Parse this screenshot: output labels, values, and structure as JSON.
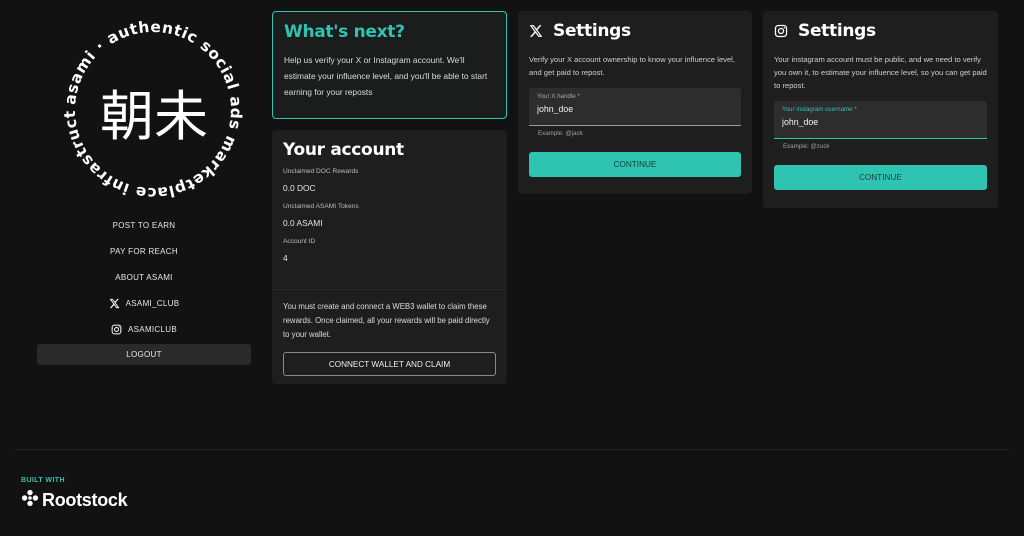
{
  "logo": {
    "ring_text": "asami · authentic social ads marketplace infrastructure ·",
    "glyph": "朝未"
  },
  "nav": {
    "items": [
      {
        "label": "POST TO EARN"
      },
      {
        "label": "PAY FOR REACH"
      },
      {
        "label": "ABOUT ASAMI"
      },
      {
        "label": "ASAMI_CLUB",
        "icon": "x-icon"
      },
      {
        "label": "ASAMICLUB",
        "icon": "instagram-icon"
      }
    ],
    "logout": "LOGOUT"
  },
  "whats_next": {
    "title": "What's next?",
    "text": "Help us verify your X or Instagram account. We'll estimate your influence level, and you'll be able to start earning for your reposts"
  },
  "account": {
    "title": "Your account",
    "fields": [
      {
        "label": "Unclaimed DOC Rewards",
        "value": "0.0 DOC"
      },
      {
        "label": "Unclaimed ASAMI Tokens",
        "value": "0.0 ASAMI"
      },
      {
        "label": "Account ID",
        "value": "4"
      }
    ],
    "claim_text": "You must create and connect a WEB3 wallet to claim these rewards. Once claimed, all your rewards will be paid directly to your wallet.",
    "claim_button": "CONNECT WALLET AND CLAIM"
  },
  "x_settings": {
    "title": "Settings",
    "text": "Verify your X account ownership to know your influence level, and get paid to repost.",
    "field_label": "Your X handle *",
    "field_value": "john_doe",
    "helper": "Example: @jack",
    "button": "CONTINUE"
  },
  "ig_settings": {
    "title": "Settings",
    "text": "Your instagram account must be public, and we need to verify you own it, to estimate your influence level, so you can get paid to repost.",
    "field_label": "Your instagram username *",
    "field_value": "john_doe",
    "helper": "Example: @zuck",
    "button": "CONTINUE"
  },
  "footer": {
    "built_with": "BUILT WITH",
    "brand": "Rootstock"
  },
  "colors": {
    "accent": "#2fc4b2",
    "background": "#121212",
    "card": "#1e1e1e"
  }
}
